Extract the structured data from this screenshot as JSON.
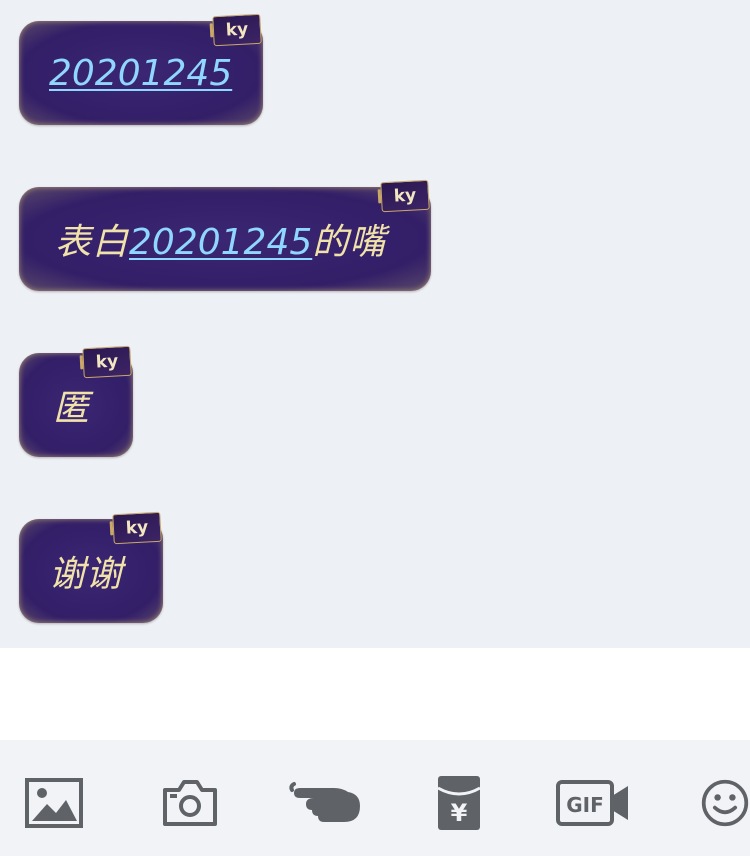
{
  "messages": [
    {
      "prefix": "",
      "link": "20201245",
      "suffix": "",
      "badge": "ky"
    },
    {
      "prefix": "表白",
      "link": "20201245",
      "suffix": "的嘴",
      "badge": "ky"
    },
    {
      "prefix": "匿",
      "link": "",
      "suffix": "",
      "badge": "ky"
    },
    {
      "prefix": "谢谢",
      "link": "",
      "suffix": "",
      "badge": "ky"
    }
  ],
  "toolbar": {
    "icons": [
      "image-icon",
      "camera-icon",
      "poke-icon",
      "red-packet-icon",
      "gif-icon",
      "emoji-icon"
    ],
    "gif_label": "GIF",
    "yuan_symbol": "¥"
  },
  "colors": {
    "bubble": "#331f68",
    "bubble_text": "#f0e2a8",
    "link": "#8fd7ff",
    "chat_background": "#edf0f5",
    "icon": "#5f6368"
  }
}
